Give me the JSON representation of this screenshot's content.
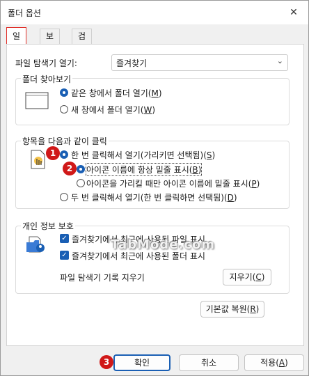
{
  "window": {
    "title": "폴더 옵션",
    "close": "✕"
  },
  "tabs": [
    "일반",
    "보기",
    "검색"
  ],
  "explorer_open": {
    "label": "파일 탐색기 열기:",
    "value": "즐겨찾기"
  },
  "browse": {
    "legend": "폴더 찾아보기",
    "opt1_pre": "같은 창에서 폴더 열기(",
    "opt1_key": "M",
    "opt1_post": ")",
    "opt2_pre": "새 창에서 폴더 열기(",
    "opt2_key": "W",
    "opt2_post": ")"
  },
  "click": {
    "legend": "항목을 다음과 같이 클릭",
    "single_pre": "한 번 클릭해서 열기(가리키면 선택됨)(",
    "single_key": "S",
    "single_post": ")",
    "always_pre": "아이콘 이름에 항상 밑줄 표시(",
    "always_key": "B",
    "always_post": ")",
    "point_pre": "아이콘을 가리킬 때만 아이콘 이름에 밑줄 표시(",
    "point_key": "P",
    "point_post": ")",
    "double_pre": "두 번 클릭해서 열기(한 번 클릭하면 선택됨)(",
    "double_key": "D",
    "double_post": ")"
  },
  "privacy": {
    "legend": "개인 정보 보호",
    "files": "즐겨찾기에서 최근에 사용된 파일 표시",
    "folders": "즐겨찾기에서 최근에 사용된 폴더 표시",
    "clear_label": "파일 탐색기 기록 지우기",
    "clear_btn_pre": "지우기(",
    "clear_btn_key": "C",
    "clear_btn_post": ")"
  },
  "restore_pre": "기본값 복원(",
  "restore_key": "R",
  "restore_post": ")",
  "footer": {
    "ok": "확인",
    "cancel": "취소",
    "apply_pre": "적용(",
    "apply_key": "A",
    "apply_post": ")"
  },
  "badges": [
    "1",
    "2",
    "3"
  ],
  "watermark": "TabMode.com",
  "colors": {
    "accent": "#1a5fb4",
    "badge": "#d01818",
    "tab_highlight": "#e0302a"
  }
}
